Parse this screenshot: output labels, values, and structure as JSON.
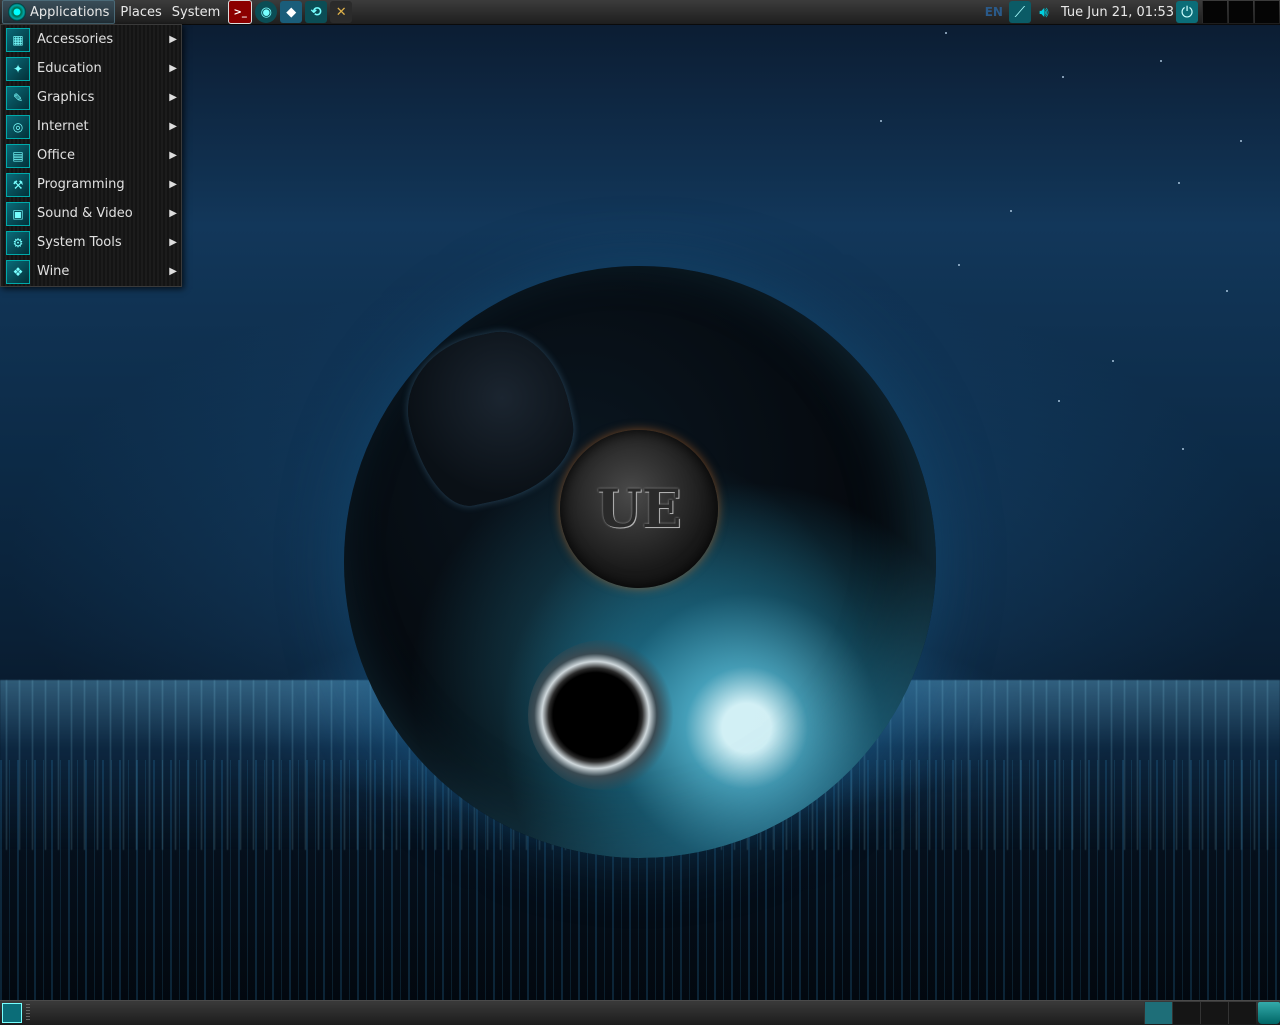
{
  "top_panel": {
    "menus": [
      "Applications",
      "Places",
      "System"
    ],
    "launchers": [
      {
        "icon": "terminal-icon"
      },
      {
        "icon": "ubuntu-eye-icon"
      },
      {
        "icon": "kdevelop-icon"
      },
      {
        "icon": "system-icon"
      },
      {
        "icon": "tools-icon"
      }
    ],
    "tray": {
      "keyboard_layout": "EN",
      "clock": "Tue Jun 21, 01:53"
    }
  },
  "apps_menu": {
    "items": [
      {
        "label": "Accessories",
        "icon": "accessories-icon"
      },
      {
        "label": "Education",
        "icon": "education-icon"
      },
      {
        "label": "Graphics",
        "icon": "graphics-icon"
      },
      {
        "label": "Internet",
        "icon": "internet-icon"
      },
      {
        "label": "Office",
        "icon": "office-icon"
      },
      {
        "label": "Programming",
        "icon": "programming-icon"
      },
      {
        "label": "Sound & Video",
        "icon": "sound-video-icon"
      },
      {
        "label": "System Tools",
        "icon": "system-tools-icon"
      },
      {
        "label": "Wine",
        "icon": "wine-icon"
      }
    ]
  },
  "wallpaper": {
    "emblem_text": "UE"
  },
  "colors": {
    "accent": "#00c8d8",
    "panel": "#2a2a2a",
    "menu_bg": "#181818",
    "text": "#e0e0e0"
  }
}
